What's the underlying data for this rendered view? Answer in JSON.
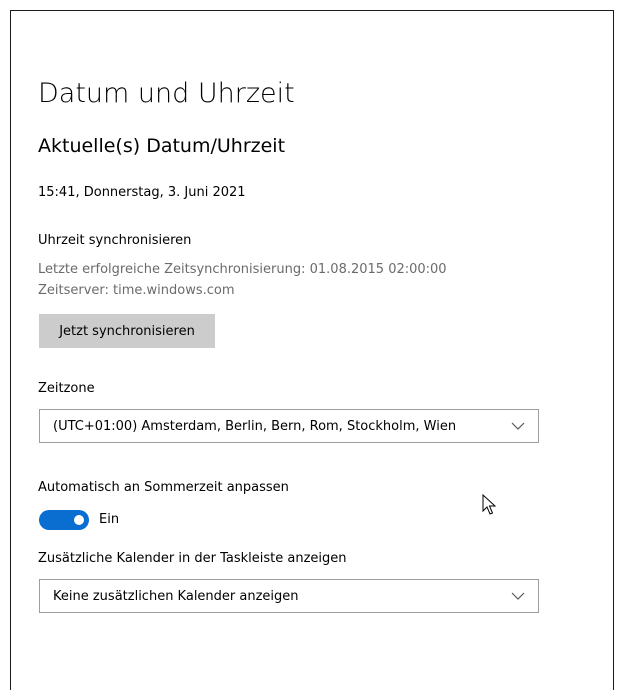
{
  "page": {
    "title": "Datum und Uhrzeit",
    "section_title": "Aktuelle(s) Datum/Uhrzeit",
    "current_datetime": "15:41, Donnerstag, 3. Juni 2021"
  },
  "sync": {
    "heading": "Uhrzeit synchronisieren",
    "last_sync": "Letzte erfolgreiche Zeitsynchronisierung: 01.08.2015 02:00:00",
    "server": "Zeitserver: time.windows.com",
    "button_label": "Jetzt synchronisieren"
  },
  "timezone": {
    "label": "Zeitzone",
    "value": "(UTC+01:00) Amsterdam, Berlin, Bern, Rom, Stockholm, Wien"
  },
  "dst": {
    "label": "Automatisch an Sommerzeit anpassen",
    "toggle_on": true,
    "toggle_state": "Ein"
  },
  "calendar": {
    "label": "Zusätzliche Kalender in der Taskleiste anzeigen",
    "value": "Keine zusätzlichen Kalender anzeigen"
  },
  "colors": {
    "accent": "#0a6ed1",
    "button_bg": "#cccccc",
    "secondary_text": "#6b6b6b"
  },
  "icons": {
    "dropdown": "chevron-down-icon",
    "pointer": "mouse-cursor-icon"
  }
}
